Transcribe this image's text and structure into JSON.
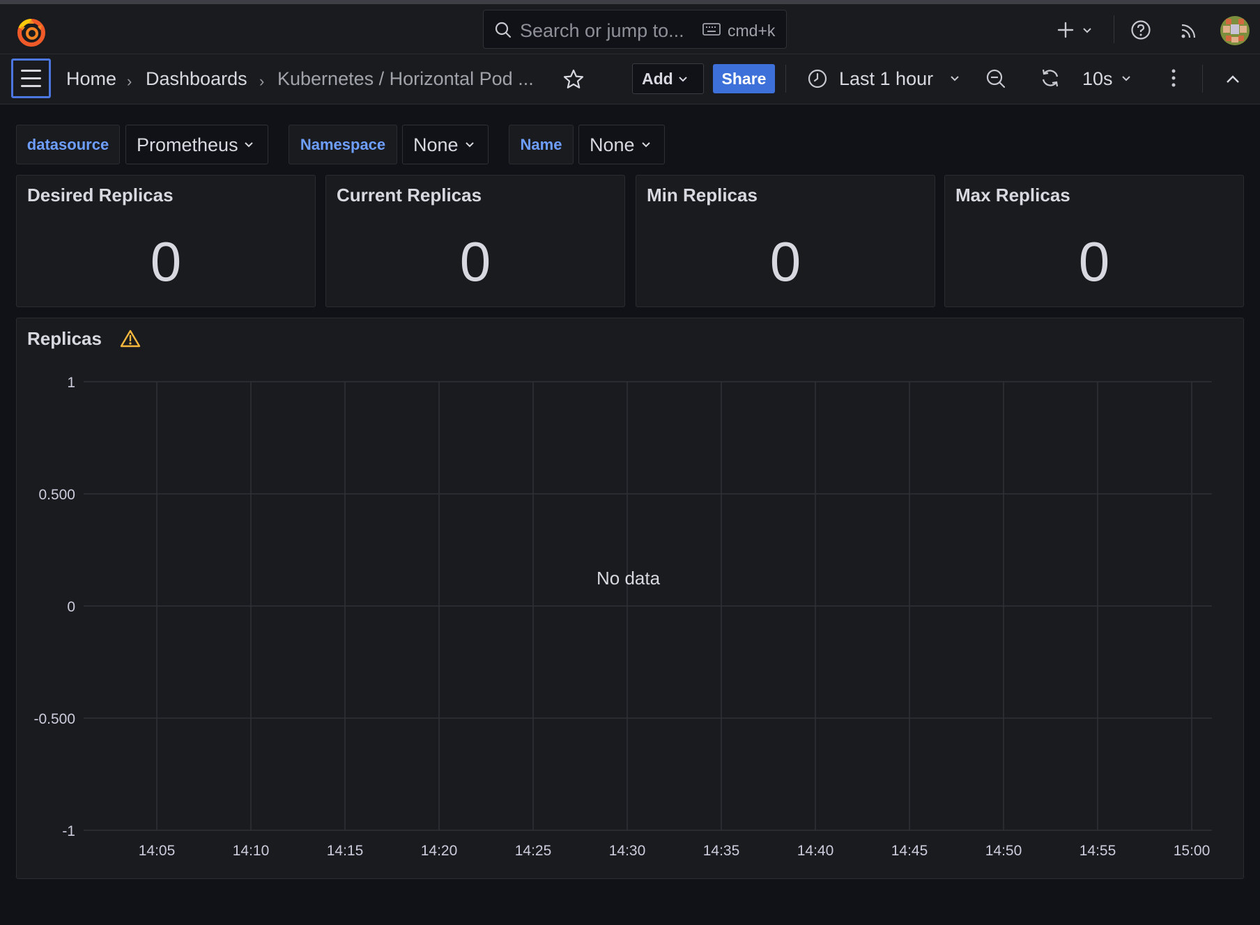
{
  "search": {
    "placeholder": "Search or jump to...",
    "shortcut": "cmd+k"
  },
  "breadcrumb": {
    "home": "Home",
    "dashboards": "Dashboards",
    "current": "Kubernetes / Horizontal Pod ..."
  },
  "toolbar": {
    "add_label": "Add",
    "share_label": "Share",
    "time_range": "Last 1 hour",
    "refresh_interval": "10s"
  },
  "variables": [
    {
      "label": "datasource",
      "value": "Prometheus"
    },
    {
      "label": "Namespace",
      "value": "None"
    },
    {
      "label": "Name",
      "value": "None"
    }
  ],
  "stats": [
    {
      "title": "Desired Replicas",
      "value": "0"
    },
    {
      "title": "Current Replicas",
      "value": "0"
    },
    {
      "title": "Min Replicas",
      "value": "0"
    },
    {
      "title": "Max Replicas",
      "value": "0"
    }
  ],
  "graph": {
    "title": "Replicas",
    "no_data": "No data"
  },
  "colors": {
    "accent": "#3d71d9",
    "link": "#6e9fff",
    "warning": "#f5b73d",
    "background": "#111217",
    "panel": "#1a1b1f"
  },
  "chart_data": {
    "type": "line",
    "title": "Replicas",
    "xlabel": "",
    "ylabel": "",
    "ylim": [
      -1,
      1
    ],
    "yticks": [
      "1",
      "0.500",
      "0",
      "-0.500",
      "-1"
    ],
    "yvalues": [
      1,
      0.5,
      0,
      -0.5,
      -1
    ],
    "xticks": [
      "14:05",
      "14:10",
      "14:15",
      "14:20",
      "14:25",
      "14:30",
      "14:35",
      "14:40",
      "14:45",
      "14:50",
      "14:55",
      "15:00"
    ],
    "grid": true,
    "series": [],
    "annotation": "No data"
  }
}
